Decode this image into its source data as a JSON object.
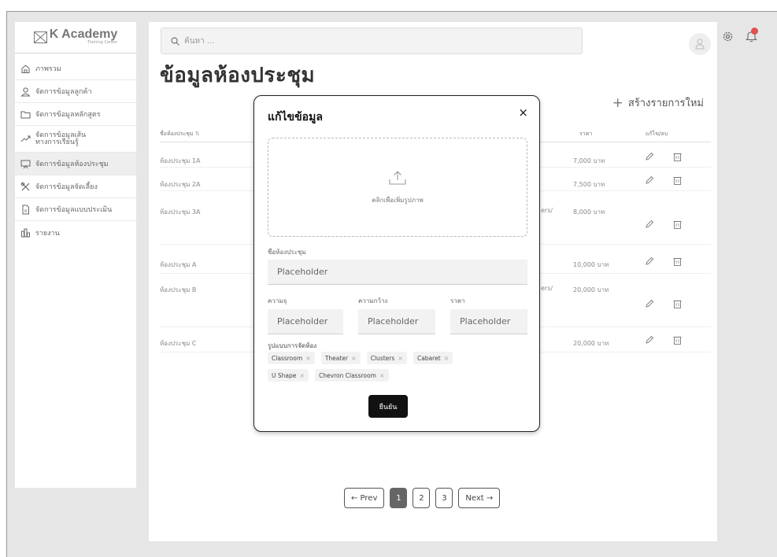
{
  "brand": {
    "name": "K Academy",
    "subtitle": "Training Center"
  },
  "sidebar": {
    "items": [
      {
        "label": "ภาพรวม",
        "icon": "home-icon"
      },
      {
        "label": "จัดการข้อมูลลูกค้า",
        "icon": "user-icon"
      },
      {
        "label": "จัดการข้อมูลหลักสูตร",
        "icon": "folder-icon"
      },
      {
        "label": "จัดการข้อมูลเส้นทางการเรียนรู้",
        "icon": "trend-icon"
      },
      {
        "label": "จัดการข้อมูลห้องประชุม",
        "icon": "screen-icon"
      },
      {
        "label": "จัดการข้อมูลจัดเลี้ยง",
        "icon": "utensils-icon"
      },
      {
        "label": "จัดการข้อมูลแบบประเมิน",
        "icon": "document-icon"
      },
      {
        "label": "รายงาน",
        "icon": "chart-icon"
      }
    ]
  },
  "header": {
    "search_placeholder": "ค้นหา ...",
    "notification_color": "#e05050"
  },
  "page": {
    "title": "ข้อมูลห้องประชุม",
    "create_label": "สร้างรายการใหม่"
  },
  "table": {
    "columns": {
      "name": "ชื่อห้องประชุม",
      "price": "ราคา",
      "actions": "แก้ไข/ลบ"
    },
    "rows": [
      {
        "name": "ห้องประชุม 1A",
        "extra": "",
        "price": "7,000 บาท"
      },
      {
        "name": "ห้องประชุม 2A",
        "extra": "",
        "price": "7,500 บาท"
      },
      {
        "name": "ห้องประชุม 3A",
        "extra": "ers/",
        "price": "8,000 บาท"
      },
      {
        "name": "ห้องประชุม A",
        "extra": "",
        "price": "10,000 บาท"
      },
      {
        "name": "ห้องประชุม B",
        "extra": "ers/",
        "price": "20,000 บาท"
      },
      {
        "name": "ห้องประชุม C",
        "extra": "",
        "price": "20,000 บาท"
      }
    ]
  },
  "pagination": {
    "prev": "← Prev",
    "pages": [
      "1",
      "2",
      "3"
    ],
    "current": "1",
    "next": "Next →"
  },
  "modal": {
    "title": "แก้ไขข้อมูล",
    "close": "×",
    "upload_label": "คลิกเพื่อเพิ่มรูปภาพ",
    "room_name_label": "ชื่อห้องประชุม",
    "room_name_placeholder": "Placeholder",
    "capacity_label": "ความจุ",
    "capacity_placeholder": "Placeholder",
    "width_label": "ความกว้าง",
    "width_placeholder": "Placeholder",
    "price_label": "ราคา",
    "price_placeholder": "Placeholder",
    "layout_label": "รูปแบบการจัดห้อง",
    "layouts_row1": [
      "Classroom",
      "Theater",
      "Clusters",
      "Cabaret"
    ],
    "layouts_row2": [
      "U Shape",
      "Chevron Classroom"
    ],
    "confirm_label": "ยืนยัน"
  }
}
